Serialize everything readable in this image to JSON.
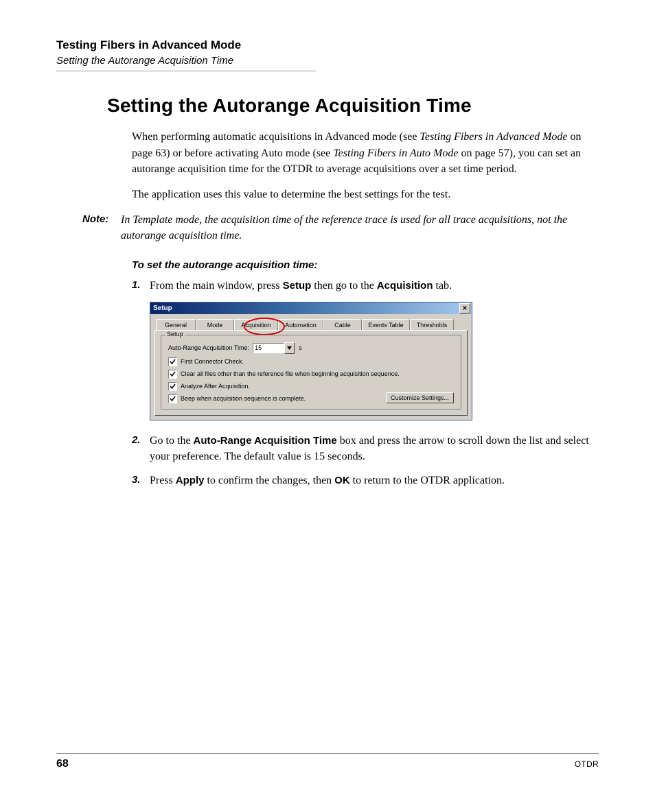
{
  "header": {
    "chapter": "Testing Fibers in Advanced Mode",
    "section": "Setting the Autorange Acquisition Time"
  },
  "title": "Setting the Autorange Acquisition Time",
  "intro": {
    "p1a": "When performing automatic acquisitions in Advanced mode (see ",
    "p1b": "Testing Fibers in Advanced Mode",
    "p1c": " on page 63) or before activating Auto mode (see ",
    "p1d": "Testing Fibers in Auto Mode",
    "p1e": " on page 57), you can set an autorange acquisition time for the OTDR to average acquisitions over a set time period.",
    "p2": "The application uses this value to determine the best settings for the test."
  },
  "note": {
    "label": "Note:",
    "text": "In Template mode, the acquisition time of the reference trace is used for all trace acquisitions, not the autorange acquisition time."
  },
  "task": {
    "heading": "To set the autorange acquisition time:",
    "steps": [
      {
        "n": "1.",
        "pre": "From the main window, press ",
        "b1": "Setup",
        "mid": " then go to the ",
        "b2": "Acquisition",
        "post": " tab."
      },
      {
        "n": "2.",
        "pre": "Go to the ",
        "b1": "Auto-Range Acquisition Time",
        "mid": " box and press the arrow to scroll down the list and select your preference. The default value is 15 seconds.",
        "b2": "",
        "post": ""
      },
      {
        "n": "3.",
        "pre": "Press ",
        "b1": "Apply",
        "mid": " to confirm the changes, then ",
        "b2": "OK",
        "post": " to return to the OTDR application."
      }
    ]
  },
  "dialog": {
    "title": "Setup",
    "tabs": [
      "General",
      "Mode",
      "Acquisition",
      "Automation",
      "Cable",
      "Events Table",
      "Thresholds"
    ],
    "group_label": "Setup",
    "row_label": "Auto-Range Acquisition Time:",
    "row_value": "15",
    "row_unit": "s",
    "chk1": "First Connector Check.",
    "chk2": "Clear all files other than the reference file when beginning acquisition sequence.",
    "chk3": "Analyze After Acquisition.",
    "chk4": "Beep when acquisition sequence is complete.",
    "button": "Customize Settings..."
  },
  "footer": {
    "page": "68",
    "product": "OTDR"
  }
}
